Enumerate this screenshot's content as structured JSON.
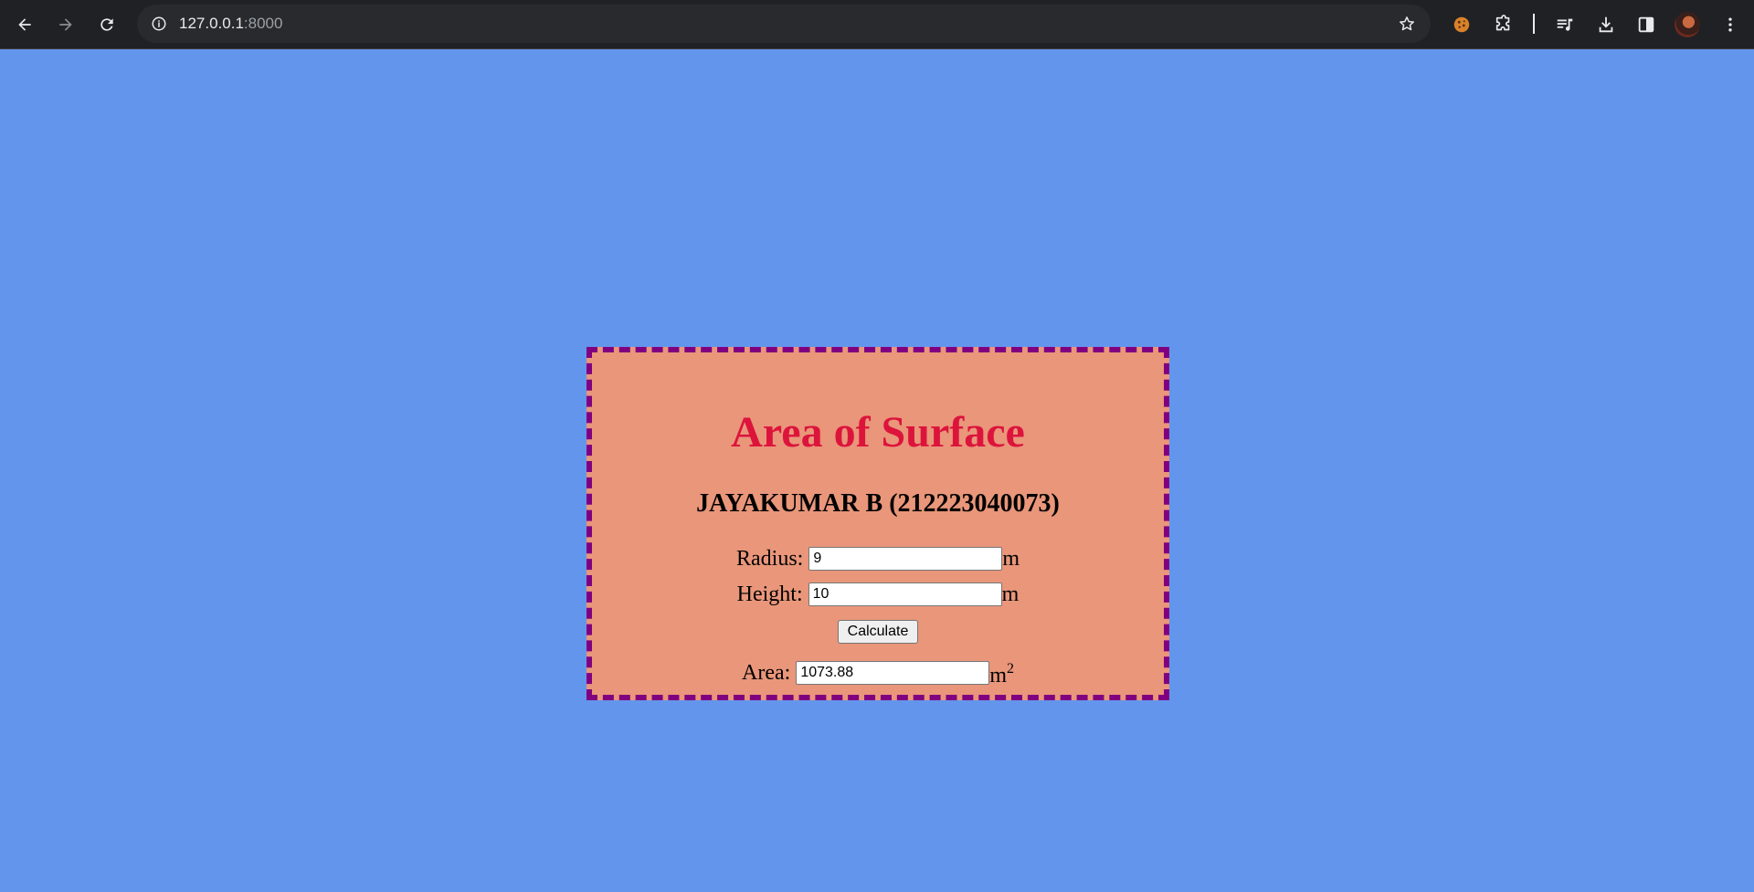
{
  "browser": {
    "url_host": "127.0.0.1",
    "url_port": ":8000",
    "icons": {
      "back": "back-arrow-icon",
      "forward": "forward-arrow-icon",
      "reload": "reload-icon",
      "site_info": "info-icon",
      "bookmark": "star-icon",
      "cookie_extension": "cookie-icon",
      "extensions": "puzzle-icon",
      "media": "media-control-icon",
      "downloads": "download-icon",
      "side_panel": "side-panel-icon",
      "profile": "avatar",
      "menu": "kebab-menu-icon"
    }
  },
  "page": {
    "background_color": "#6495ed",
    "card_color": "#e9967a",
    "border_color": "#800080",
    "title_color": "#dc143c",
    "title": "Area of Surface",
    "subtitle": "JAYAKUMAR B (212223040073)",
    "radius": {
      "label": "Radius:",
      "value": "9",
      "unit": "m"
    },
    "height": {
      "label": "Height:",
      "value": "10",
      "unit": "m"
    },
    "calculate_label": "Calculate",
    "area": {
      "label": "Area:",
      "value": "1073.88",
      "unit": "m",
      "unit_exponent": "2"
    }
  }
}
